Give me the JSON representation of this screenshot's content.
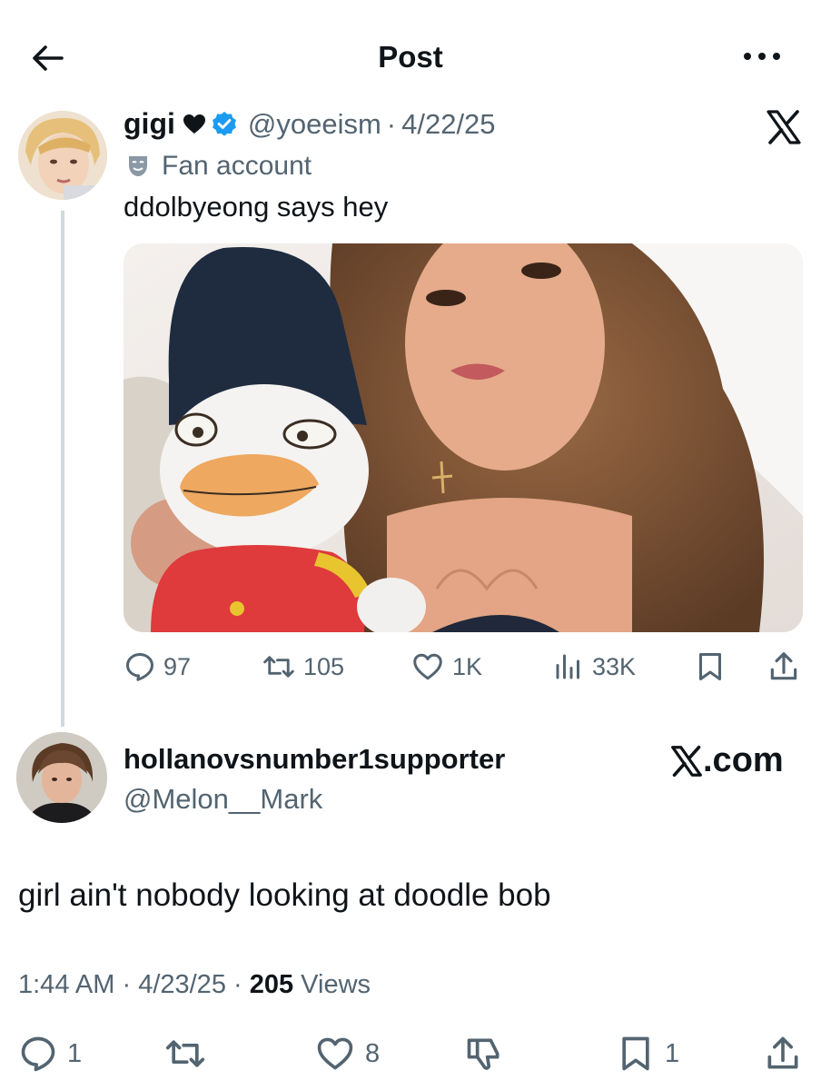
{
  "header": {
    "title": "Post"
  },
  "quoted": {
    "name": "gigi",
    "handle": "@yoeeism",
    "separator": "·",
    "date": "4/22/25",
    "label": "Fan account",
    "text": "ddolbyeong says hey",
    "stats": {
      "replies": "97",
      "reposts": "105",
      "likes": "1K",
      "views": "33K"
    }
  },
  "reply": {
    "name": "hollanovsnumber1supporter",
    "handle": "@Melon__Mark",
    "source": ".com",
    "text": "girl ain't nobody looking at doodle bob",
    "time": "1:44 AM",
    "sep1": " · ",
    "date": "4/23/25",
    "sep2": " · ",
    "views_count": "205",
    "views_label": " Views",
    "stats": {
      "replies": "1",
      "likes": "8",
      "bookmarks": "1"
    }
  },
  "colors": {
    "text": "#0f1419",
    "secondary": "#536471",
    "verified": "#1d9bf0",
    "thread_line": "#cfd9de"
  },
  "icons": [
    "back-arrow-icon",
    "more-icon",
    "heart-emoji-icon",
    "verified-icon",
    "x-logo-icon",
    "mask-icon",
    "reply-icon",
    "repost-icon",
    "like-icon",
    "views-icon",
    "bookmark-icon",
    "share-icon",
    "dislike-icon"
  ]
}
